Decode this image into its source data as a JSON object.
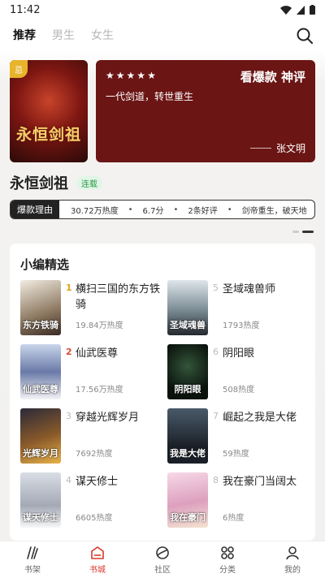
{
  "status_bar": {
    "time": "11:42"
  },
  "nav": {
    "tabs": [
      {
        "label": "推荐",
        "active": true
      },
      {
        "label": "男生",
        "active": false
      },
      {
        "label": "女生",
        "active": false
      }
    ]
  },
  "hero": {
    "cover_badge": "忌",
    "cover_title": "永恒剑祖",
    "stars": 5,
    "tag": "看爆款 神评",
    "quote": "一代剑道，转世重生",
    "author": "张文明",
    "card_color": "#6b1515"
  },
  "book": {
    "title": "永恒剑祖",
    "status": "连载",
    "reason_label": "爆款理由",
    "reasons": [
      "30.72万热度",
      "6.7分",
      "2条好评",
      "剑帝重生，破天地"
    ]
  },
  "picks": {
    "title": "小编精选",
    "items": [
      {
        "rank": "1",
        "name": "横扫三国的东方铁骑",
        "heat": "19.84万热度",
        "cover_text": "东方铁骑"
      },
      {
        "rank": "5",
        "name": "圣域魂兽师",
        "heat": "1793热度",
        "cover_text": "圣域魂兽"
      },
      {
        "rank": "2",
        "name": "仙武医尊",
        "heat": "17.56万热度",
        "cover_text": "仙武医尊"
      },
      {
        "rank": "6",
        "name": "阴阳眼",
        "heat": "508热度",
        "cover_text": "阴阳眼"
      },
      {
        "rank": "3",
        "name": "穿越光辉岁月",
        "heat": "7692热度",
        "cover_text": "光辉岁月"
      },
      {
        "rank": "7",
        "name": "崛起之我是大佬",
        "heat": "59热度",
        "cover_text": "我是大佬"
      },
      {
        "rank": "4",
        "name": "谋天修士",
        "heat": "6605热度",
        "cover_text": "谋天修士"
      },
      {
        "rank": "8",
        "name": "我在豪门当阔太",
        "heat": "6热度",
        "cover_text": "我在豪门"
      }
    ]
  },
  "tabbar": {
    "items": [
      {
        "label": "书架",
        "icon": "bookshelf-icon",
        "active": false
      },
      {
        "label": "书城",
        "icon": "bookstore-icon",
        "active": true
      },
      {
        "label": "社区",
        "icon": "community-icon",
        "active": false
      },
      {
        "label": "分类",
        "icon": "category-icon",
        "active": false
      },
      {
        "label": "我的",
        "icon": "profile-icon",
        "active": false
      }
    ]
  },
  "colors": {
    "accent": "#d9382e",
    "tag_green": "#2a9a4a"
  }
}
